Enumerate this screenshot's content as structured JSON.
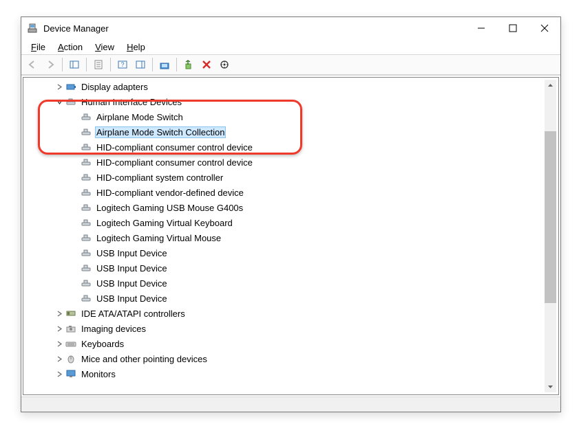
{
  "title": "Device Manager",
  "menus": {
    "file": "File",
    "action": "Action",
    "view": "View",
    "help": "Help"
  },
  "tree": {
    "display_adapters": "Display adapters",
    "hid": {
      "label": "Human Interface Devices",
      "children": [
        "Airplane Mode Switch",
        "Airplane Mode Switch Collection",
        "HID-compliant consumer control device",
        "HID-compliant consumer control device",
        "HID-compliant system controller",
        "HID-compliant vendor-defined device",
        "Logitech Gaming USB Mouse G400s",
        "Logitech Gaming Virtual Keyboard",
        "Logitech Gaming Virtual Mouse",
        "USB Input Device",
        "USB Input Device",
        "USB Input Device",
        "USB Input Device"
      ]
    },
    "ide": "IDE ATA/ATAPI controllers",
    "imaging": "Imaging devices",
    "keyboards": "Keyboards",
    "mice": "Mice and other pointing devices",
    "monitors": "Monitors"
  },
  "selected_index": 1
}
